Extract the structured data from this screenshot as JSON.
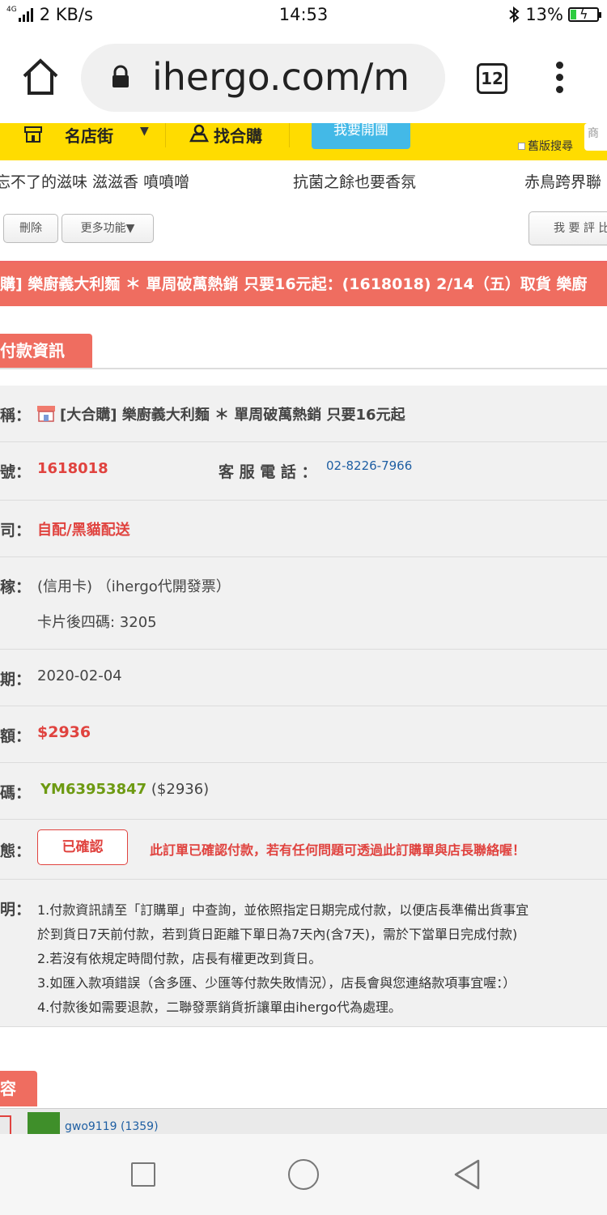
{
  "status_bar": {
    "network": "4G",
    "speed": "2 KB/s",
    "time": "14:53",
    "battery": "13%"
  },
  "browser": {
    "url": "ihergo.com/m",
    "tab_count": "12"
  },
  "top_nav": {
    "store_street": "名店街",
    "find_group_buy": "找合購",
    "open_group": "我要開團",
    "old_search": "舊版搜尋",
    "search_stub": "商"
  },
  "marquee": [
    "忘不了的滋味 滋滋香 噴噴噌",
    "抗菌之餘也要香氛",
    "赤鳥跨界聯"
  ],
  "actions": {
    "delete": "刪除",
    "more": "更多功能▼",
    "review": "我 要 評 比"
  },
  "banner": "購] 樂廚義大利麵 ＊ 單周破萬熱銷 只要16元起：(1618018) 2/14（五）取貨 樂廚",
  "section_tab": "付款資訊",
  "rows": {
    "name": {
      "label": "稱：",
      "value": "[大合購] 樂廚義大利麵 ＊ 單周破萬熱銷 只要16元起"
    },
    "id": {
      "label": "號：",
      "value": "1618018",
      "phone_label": "客 服 電 話 ：",
      "phone": "02-8226-7966"
    },
    "shipping": {
      "label": "司：",
      "value": "自配/黑貓配送"
    },
    "payment": {
      "label": "稼：",
      "value": "(信用卡) （ihergo代開發票）",
      "card": "卡片後四碼: 3205"
    },
    "date": {
      "label": "期：",
      "value": "2020-02-04"
    },
    "amount": {
      "label": "額：",
      "value": "$2936"
    },
    "code": {
      "label": "碼：",
      "value": "YM63953847",
      "extra": "($2936)"
    },
    "status": {
      "label": "態：",
      "button": "已確認",
      "message": "此訂單已確認付款，若有任何問題可透過此訂購單與店長聯絡喔！"
    },
    "notes": {
      "label": "明：",
      "lines": [
        "1.付款資訊請至「訂購單」中查詢，並依照指定日期完成付款，以便店長準備出貨事宜",
        "於到貨日7天前付款，若到貨日距離下單日為7天內(含7天)，需於下當單日完成付款)",
        "2.若沒有依規定時間付款，店長有權更改到貨日。",
        "3.如匯入款項錯誤（含多匯、少匯等付款失敗情況），店長會與您連絡款項事宜喔：）",
        "4.付款後如需要退款，二聯發票銷貨折讓單由ihergo代為處理。"
      ]
    }
  },
  "content_tab": "容",
  "bottom_user": "gwo9119 (1359)",
  "colors": {
    "accent_red": "#ef6d60",
    "nav_yellow": "#ffdc00",
    "button_blue": "#43b9e7",
    "green_code": "#6d9a12"
  }
}
